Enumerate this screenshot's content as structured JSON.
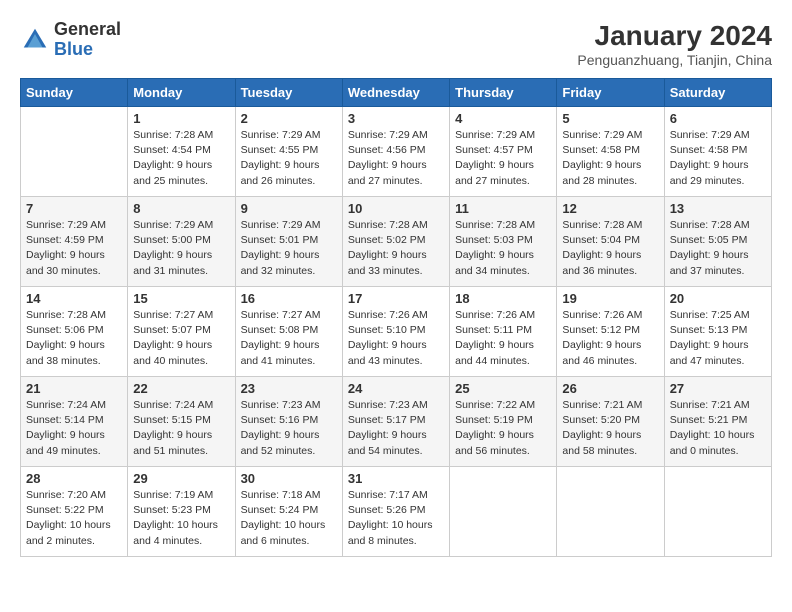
{
  "header": {
    "logo_general": "General",
    "logo_blue": "Blue",
    "month_year": "January 2024",
    "location": "Penguanzhuang, Tianjin, China"
  },
  "days_of_week": [
    "Sunday",
    "Monday",
    "Tuesday",
    "Wednesday",
    "Thursday",
    "Friday",
    "Saturday"
  ],
  "weeks": [
    [
      {
        "day": "",
        "info": ""
      },
      {
        "day": "1",
        "info": "Sunrise: 7:28 AM\nSunset: 4:54 PM\nDaylight: 9 hours\nand 25 minutes."
      },
      {
        "day": "2",
        "info": "Sunrise: 7:29 AM\nSunset: 4:55 PM\nDaylight: 9 hours\nand 26 minutes."
      },
      {
        "day": "3",
        "info": "Sunrise: 7:29 AM\nSunset: 4:56 PM\nDaylight: 9 hours\nand 27 minutes."
      },
      {
        "day": "4",
        "info": "Sunrise: 7:29 AM\nSunset: 4:57 PM\nDaylight: 9 hours\nand 27 minutes."
      },
      {
        "day": "5",
        "info": "Sunrise: 7:29 AM\nSunset: 4:58 PM\nDaylight: 9 hours\nand 28 minutes."
      },
      {
        "day": "6",
        "info": "Sunrise: 7:29 AM\nSunset: 4:58 PM\nDaylight: 9 hours\nand 29 minutes."
      }
    ],
    [
      {
        "day": "7",
        "info": "Sunrise: 7:29 AM\nSunset: 4:59 PM\nDaylight: 9 hours\nand 30 minutes."
      },
      {
        "day": "8",
        "info": "Sunrise: 7:29 AM\nSunset: 5:00 PM\nDaylight: 9 hours\nand 31 minutes."
      },
      {
        "day": "9",
        "info": "Sunrise: 7:29 AM\nSunset: 5:01 PM\nDaylight: 9 hours\nand 32 minutes."
      },
      {
        "day": "10",
        "info": "Sunrise: 7:28 AM\nSunset: 5:02 PM\nDaylight: 9 hours\nand 33 minutes."
      },
      {
        "day": "11",
        "info": "Sunrise: 7:28 AM\nSunset: 5:03 PM\nDaylight: 9 hours\nand 34 minutes."
      },
      {
        "day": "12",
        "info": "Sunrise: 7:28 AM\nSunset: 5:04 PM\nDaylight: 9 hours\nand 36 minutes."
      },
      {
        "day": "13",
        "info": "Sunrise: 7:28 AM\nSunset: 5:05 PM\nDaylight: 9 hours\nand 37 minutes."
      }
    ],
    [
      {
        "day": "14",
        "info": "Sunrise: 7:28 AM\nSunset: 5:06 PM\nDaylight: 9 hours\nand 38 minutes."
      },
      {
        "day": "15",
        "info": "Sunrise: 7:27 AM\nSunset: 5:07 PM\nDaylight: 9 hours\nand 40 minutes."
      },
      {
        "day": "16",
        "info": "Sunrise: 7:27 AM\nSunset: 5:08 PM\nDaylight: 9 hours\nand 41 minutes."
      },
      {
        "day": "17",
        "info": "Sunrise: 7:26 AM\nSunset: 5:10 PM\nDaylight: 9 hours\nand 43 minutes."
      },
      {
        "day": "18",
        "info": "Sunrise: 7:26 AM\nSunset: 5:11 PM\nDaylight: 9 hours\nand 44 minutes."
      },
      {
        "day": "19",
        "info": "Sunrise: 7:26 AM\nSunset: 5:12 PM\nDaylight: 9 hours\nand 46 minutes."
      },
      {
        "day": "20",
        "info": "Sunrise: 7:25 AM\nSunset: 5:13 PM\nDaylight: 9 hours\nand 47 minutes."
      }
    ],
    [
      {
        "day": "21",
        "info": "Sunrise: 7:24 AM\nSunset: 5:14 PM\nDaylight: 9 hours\nand 49 minutes."
      },
      {
        "day": "22",
        "info": "Sunrise: 7:24 AM\nSunset: 5:15 PM\nDaylight: 9 hours\nand 51 minutes."
      },
      {
        "day": "23",
        "info": "Sunrise: 7:23 AM\nSunset: 5:16 PM\nDaylight: 9 hours\nand 52 minutes."
      },
      {
        "day": "24",
        "info": "Sunrise: 7:23 AM\nSunset: 5:17 PM\nDaylight: 9 hours\nand 54 minutes."
      },
      {
        "day": "25",
        "info": "Sunrise: 7:22 AM\nSunset: 5:19 PM\nDaylight: 9 hours\nand 56 minutes."
      },
      {
        "day": "26",
        "info": "Sunrise: 7:21 AM\nSunset: 5:20 PM\nDaylight: 9 hours\nand 58 minutes."
      },
      {
        "day": "27",
        "info": "Sunrise: 7:21 AM\nSunset: 5:21 PM\nDaylight: 10 hours\nand 0 minutes."
      }
    ],
    [
      {
        "day": "28",
        "info": "Sunrise: 7:20 AM\nSunset: 5:22 PM\nDaylight: 10 hours\nand 2 minutes."
      },
      {
        "day": "29",
        "info": "Sunrise: 7:19 AM\nSunset: 5:23 PM\nDaylight: 10 hours\nand 4 minutes."
      },
      {
        "day": "30",
        "info": "Sunrise: 7:18 AM\nSunset: 5:24 PM\nDaylight: 10 hours\nand 6 minutes."
      },
      {
        "day": "31",
        "info": "Sunrise: 7:17 AM\nSunset: 5:26 PM\nDaylight: 10 hours\nand 8 minutes."
      },
      {
        "day": "",
        "info": ""
      },
      {
        "day": "",
        "info": ""
      },
      {
        "day": "",
        "info": ""
      }
    ]
  ]
}
